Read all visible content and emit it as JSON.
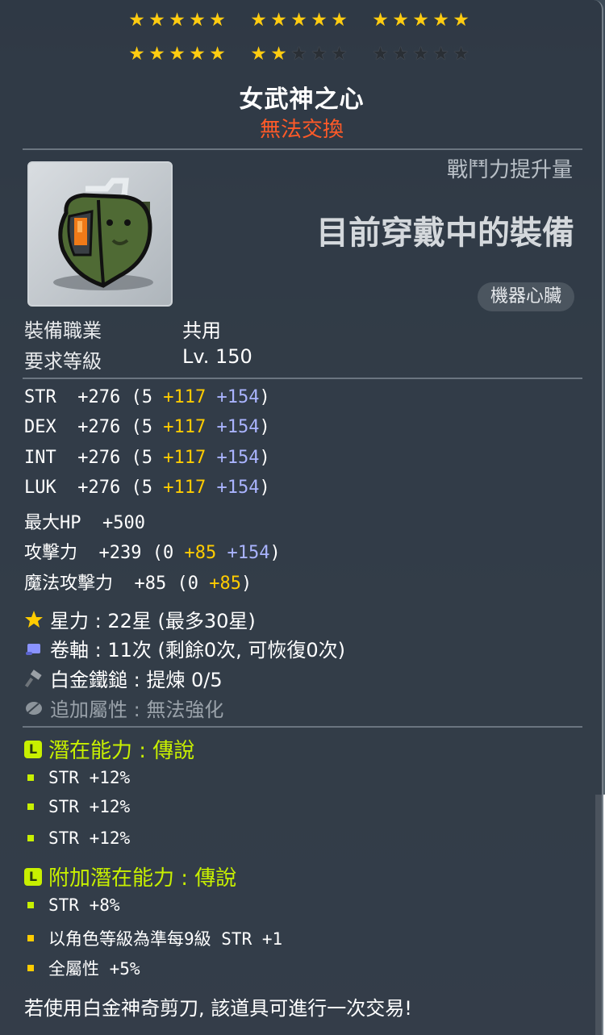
{
  "star_force": {
    "rows": [
      [
        [
          true,
          true,
          true,
          true,
          true
        ],
        [
          true,
          true,
          true,
          true,
          true
        ],
        [
          true,
          true,
          true,
          true,
          true
        ]
      ],
      [
        [
          true,
          true,
          true,
          true,
          true
        ],
        [
          true,
          true,
          false,
          false,
          false
        ],
        [
          false,
          false,
          false,
          false,
          false
        ]
      ]
    ]
  },
  "item": {
    "name": "女武神之心",
    "tradeability": "無法交換",
    "cp_label": "戰鬥力提升量",
    "cp_value": "目前穿戴中的裝備",
    "category": "機器心臟"
  },
  "requirements": {
    "job_label": "裝備職業",
    "job_value": "共用",
    "level_label": "要求等級",
    "level_value": "Lv. 150"
  },
  "stats": [
    {
      "name": "STR",
      "base": "+276 (5",
      "a": "+117",
      "b": "+154",
      "end": ")"
    },
    {
      "name": "DEX",
      "base": "+276 (5",
      "a": "+117",
      "b": "+154",
      "end": ")"
    },
    {
      "name": "INT",
      "base": "+276 (5",
      "a": "+117",
      "b": "+154",
      "end": ")"
    },
    {
      "name": "LUK",
      "base": "+276 (5",
      "a": "+117",
      "b": "+154",
      "end": ")"
    },
    {
      "name": "最大HP",
      "base": "+500",
      "a": "",
      "b": "",
      "end": ""
    },
    {
      "name": "攻擊力",
      "base": "+239 (0",
      "a": "+85",
      "b": "+154",
      "end": ")"
    },
    {
      "name": "魔法攻擊力",
      "base": "+85 (0",
      "a": "+85",
      "b": "",
      "end": ")"
    }
  ],
  "upgrades": {
    "starforce": "星力 : 22星 (最多30星)",
    "scroll": "卷軸 : 11次 (剩餘0次, 可恢復0次)",
    "hammer": "白金鐵鎚 : 提煉 0/5",
    "bonus": "追加屬性 : 無法強化"
  },
  "potential": {
    "title": "潛在能力 : 傳說",
    "lines": [
      "STR +12%",
      "STR +12%",
      "STR +12%"
    ]
  },
  "additional_potential": {
    "title": "附加潛在能力 : 傳說",
    "lines": [
      "STR +8%",
      "以角色等級為準每9級 STR +1",
      "全屬性 +5%"
    ]
  },
  "note": "若使用白金神奇剪刀, 該道具可進行一次交易!",
  "colors": {
    "gold": "#ffcc00",
    "purple": "#aab4ff",
    "legendary": "#c8f000",
    "untradeable": "#ff5a28"
  },
  "icons": [
    "star-icon",
    "scroll-icon",
    "hammer-icon",
    "leaf-icon",
    "legendary-badge-icon",
    "mechanical-heart-icon"
  ]
}
